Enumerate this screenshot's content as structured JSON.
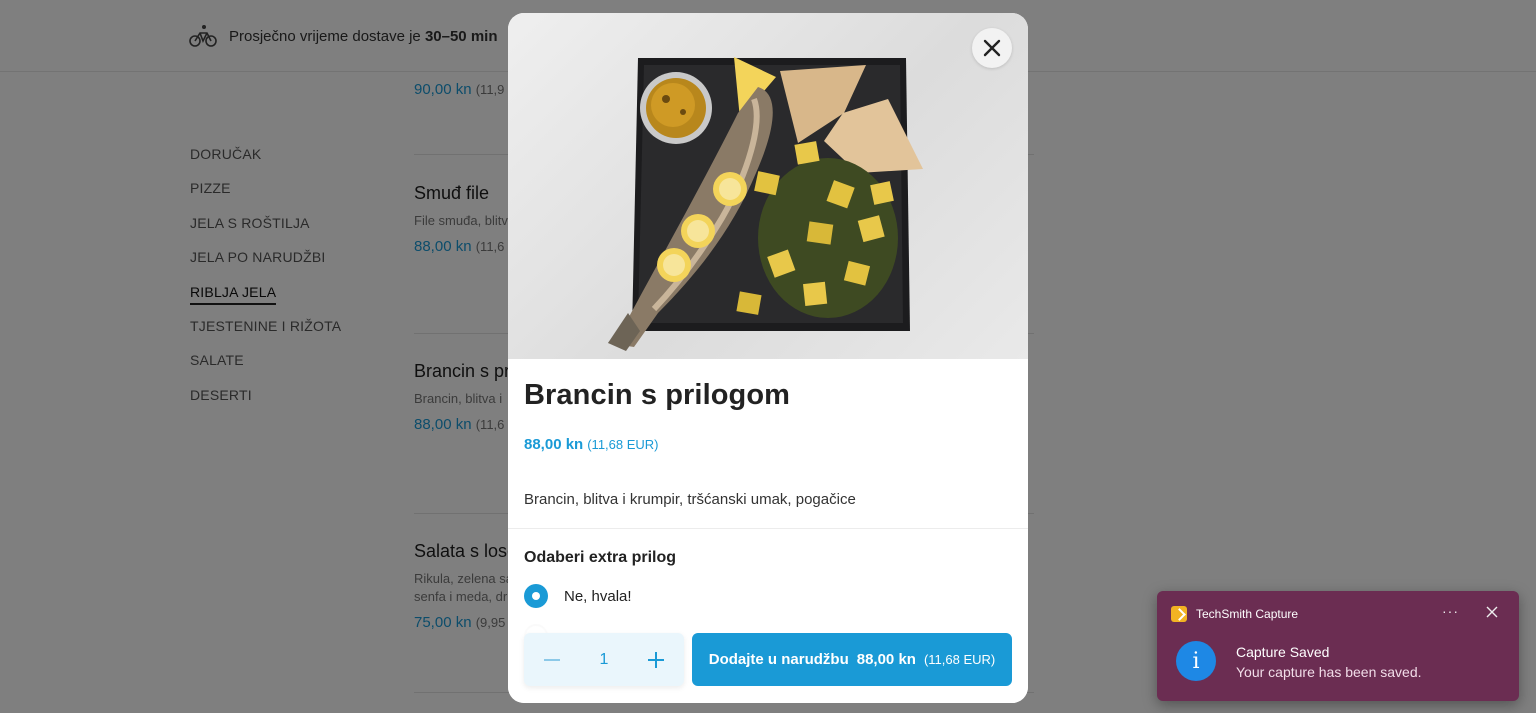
{
  "header": {
    "delivery_prefix": "Prosječno vrijeme dostave je ",
    "delivery_time": "30–50 min"
  },
  "categories": [
    {
      "label": "DORUČAK"
    },
    {
      "label": "PIZZE"
    },
    {
      "label": "JELA S ROŠTILJA"
    },
    {
      "label": "JELA PO NARUDŽBI"
    },
    {
      "label": "RIBLJA JELA",
      "active": true
    },
    {
      "label": "TJESTENINE I RIŽOTA"
    },
    {
      "label": "SALATE"
    },
    {
      "label": "DESERTI"
    }
  ],
  "menu": {
    "top_price": "90,00 kn",
    "top_price_eur": "(11,9",
    "items": [
      {
        "name": "Smuđ file",
        "desc": "File smuđa, blitv",
        "price": "88,00 kn",
        "price_eur": "(11,6"
      },
      {
        "name": "Brancin s pr",
        "desc": "Brancin, blitva i",
        "price": "88,00 kn",
        "price_eur": "(11,6"
      },
      {
        "name": "Salata s losc",
        "desc": "Rikula, zelena sa",
        "desc2": "senfa i meda, dr",
        "price": "75,00 kn",
        "price_eur": "(9,95"
      }
    ]
  },
  "modal": {
    "title": "Brancin s prilogom",
    "price": "88,00 kn",
    "price_eur": "(11,68 EUR)",
    "description": "Brancin, blitva i krumpir, tršćanski umak, pogačice",
    "extras_title": "Odaberi extra prilog",
    "options": [
      {
        "label": "Ne, hvala!",
        "selected": true
      },
      {
        "label": "",
        "selected": false
      }
    ],
    "quantity": "1",
    "add_label": "Dodajte u narudžbu",
    "add_price": "88,00 kn",
    "add_price_eur": "(11,68 EUR)"
  },
  "toast": {
    "app_name": "TechSmith Capture",
    "more": "···",
    "title": "Capture Saved",
    "message": "Your capture has been saved."
  },
  "colors": {
    "accent": "#1a9ad6",
    "toast_bg": "#6b2d52"
  }
}
